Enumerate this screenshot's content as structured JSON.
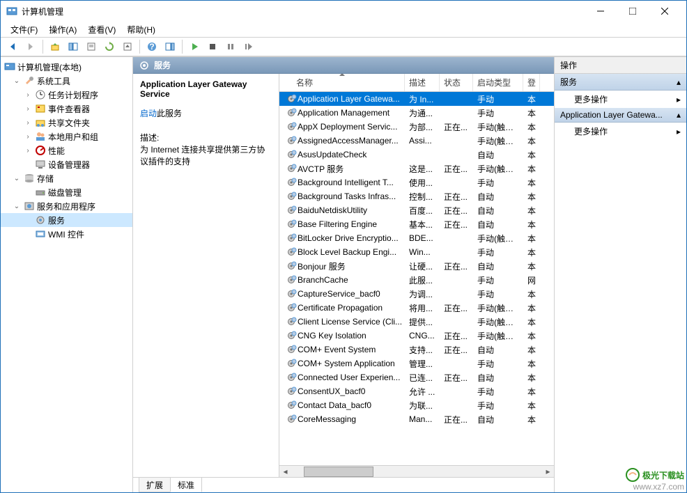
{
  "window": {
    "title": "计算机管理"
  },
  "menu": {
    "file": "文件(F)",
    "action": "操作(A)",
    "view": "查看(V)",
    "help": "帮助(H)"
  },
  "tree": {
    "root": "计算机管理(本地)",
    "system_tools": "系统工具",
    "task_scheduler": "任务计划程序",
    "event_viewer": "事件查看器",
    "shared_folders": "共享文件夹",
    "local_users": "本地用户和组",
    "performance": "性能",
    "device_manager": "设备管理器",
    "storage": "存储",
    "disk_mgmt": "磁盘管理",
    "services_apps": "服务和应用程序",
    "services": "服务",
    "wmi": "WMI 控件"
  },
  "center_header": "服务",
  "detail": {
    "name": "Application Layer Gateway Service",
    "link": "启动",
    "link_suffix": "此服务",
    "desc_label": "描述:",
    "desc": "为 Internet 连接共享提供第三方协议插件的支持"
  },
  "columns": {
    "name": "名称",
    "desc": "描述",
    "status": "状态",
    "startup": "启动类型",
    "logon": "登"
  },
  "services": [
    {
      "name": "Application Layer Gatewa...",
      "desc": "为 In...",
      "status": "",
      "startup": "手动",
      "logon": "本",
      "selected": true
    },
    {
      "name": "Application Management",
      "desc": "为通...",
      "status": "",
      "startup": "手动",
      "logon": "本"
    },
    {
      "name": "AppX Deployment Servic...",
      "desc": "为部...",
      "status": "正在...",
      "startup": "手动(触发...",
      "logon": "本"
    },
    {
      "name": "AssignedAccessManager...",
      "desc": "Assi...",
      "status": "",
      "startup": "手动(触发...",
      "logon": "本"
    },
    {
      "name": "AsusUpdateCheck",
      "desc": "",
      "status": "",
      "startup": "自动",
      "logon": "本"
    },
    {
      "name": "AVCTP 服务",
      "desc": "这是...",
      "status": "正在...",
      "startup": "手动(触发...",
      "logon": "本"
    },
    {
      "name": "Background Intelligent T...",
      "desc": "使用...",
      "status": "",
      "startup": "手动",
      "logon": "本"
    },
    {
      "name": "Background Tasks Infras...",
      "desc": "控制...",
      "status": "正在...",
      "startup": "自动",
      "logon": "本"
    },
    {
      "name": "BaiduNetdiskUtility",
      "desc": "百度...",
      "status": "正在...",
      "startup": "自动",
      "logon": "本"
    },
    {
      "name": "Base Filtering Engine",
      "desc": "基本...",
      "status": "正在...",
      "startup": "自动",
      "logon": "本"
    },
    {
      "name": "BitLocker Drive Encryptio...",
      "desc": "BDE...",
      "status": "",
      "startup": "手动(触发...",
      "logon": "本"
    },
    {
      "name": "Block Level Backup Engi...",
      "desc": "Win...",
      "status": "",
      "startup": "手动",
      "logon": "本"
    },
    {
      "name": "Bonjour 服务",
      "desc": "让硬...",
      "status": "正在...",
      "startup": "自动",
      "logon": "本"
    },
    {
      "name": "BranchCache",
      "desc": "此服...",
      "status": "",
      "startup": "手动",
      "logon": "网"
    },
    {
      "name": "CaptureService_bacf0",
      "desc": "为调...",
      "status": "",
      "startup": "手动",
      "logon": "本"
    },
    {
      "name": "Certificate Propagation",
      "desc": "将用...",
      "status": "正在...",
      "startup": "手动(触发...",
      "logon": "本"
    },
    {
      "name": "Client License Service (Cli...",
      "desc": "提供...",
      "status": "",
      "startup": "手动(触发...",
      "logon": "本"
    },
    {
      "name": "CNG Key Isolation",
      "desc": "CNG...",
      "status": "正在...",
      "startup": "手动(触发...",
      "logon": "本"
    },
    {
      "name": "COM+ Event System",
      "desc": "支持...",
      "status": "正在...",
      "startup": "自动",
      "logon": "本"
    },
    {
      "name": "COM+ System Application",
      "desc": "管理...",
      "status": "",
      "startup": "手动",
      "logon": "本"
    },
    {
      "name": "Connected User Experien...",
      "desc": "已连...",
      "status": "正在...",
      "startup": "自动",
      "logon": "本"
    },
    {
      "name": "ConsentUX_bacf0",
      "desc": "允许 ...",
      "status": "",
      "startup": "手动",
      "logon": "本"
    },
    {
      "name": "Contact Data_bacf0",
      "desc": "为联...",
      "status": "",
      "startup": "手动",
      "logon": "本"
    },
    {
      "name": "CoreMessaging",
      "desc": "Man...",
      "status": "正在...",
      "startup": "自动",
      "logon": "本"
    }
  ],
  "tabs": {
    "extended": "扩展",
    "standard": "标准"
  },
  "actions": {
    "title": "操作",
    "group1": "服务",
    "more1": "更多操作",
    "group2": "Application Layer Gatewa...",
    "more2": "更多操作"
  },
  "watermark": {
    "brand": "极光下载站",
    "url": "www.xz7.com"
  }
}
